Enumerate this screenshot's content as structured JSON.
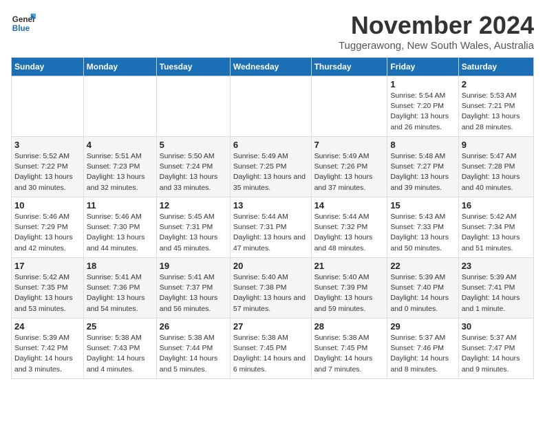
{
  "header": {
    "logo_line1": "General",
    "logo_line2": "Blue",
    "month": "November 2024",
    "location": "Tuggerawong, New South Wales, Australia"
  },
  "weekdays": [
    "Sunday",
    "Monday",
    "Tuesday",
    "Wednesday",
    "Thursday",
    "Friday",
    "Saturday"
  ],
  "weeks": [
    [
      {
        "day": "",
        "detail": ""
      },
      {
        "day": "",
        "detail": ""
      },
      {
        "day": "",
        "detail": ""
      },
      {
        "day": "",
        "detail": ""
      },
      {
        "day": "",
        "detail": ""
      },
      {
        "day": "1",
        "detail": "Sunrise: 5:54 AM\nSunset: 7:20 PM\nDaylight: 13 hours and 26 minutes."
      },
      {
        "day": "2",
        "detail": "Sunrise: 5:53 AM\nSunset: 7:21 PM\nDaylight: 13 hours and 28 minutes."
      }
    ],
    [
      {
        "day": "3",
        "detail": "Sunrise: 5:52 AM\nSunset: 7:22 PM\nDaylight: 13 hours and 30 minutes."
      },
      {
        "day": "4",
        "detail": "Sunrise: 5:51 AM\nSunset: 7:23 PM\nDaylight: 13 hours and 32 minutes."
      },
      {
        "day": "5",
        "detail": "Sunrise: 5:50 AM\nSunset: 7:24 PM\nDaylight: 13 hours and 33 minutes."
      },
      {
        "day": "6",
        "detail": "Sunrise: 5:49 AM\nSunset: 7:25 PM\nDaylight: 13 hours and 35 minutes."
      },
      {
        "day": "7",
        "detail": "Sunrise: 5:49 AM\nSunset: 7:26 PM\nDaylight: 13 hours and 37 minutes."
      },
      {
        "day": "8",
        "detail": "Sunrise: 5:48 AM\nSunset: 7:27 PM\nDaylight: 13 hours and 39 minutes."
      },
      {
        "day": "9",
        "detail": "Sunrise: 5:47 AM\nSunset: 7:28 PM\nDaylight: 13 hours and 40 minutes."
      }
    ],
    [
      {
        "day": "10",
        "detail": "Sunrise: 5:46 AM\nSunset: 7:29 PM\nDaylight: 13 hours and 42 minutes."
      },
      {
        "day": "11",
        "detail": "Sunrise: 5:46 AM\nSunset: 7:30 PM\nDaylight: 13 hours and 44 minutes."
      },
      {
        "day": "12",
        "detail": "Sunrise: 5:45 AM\nSunset: 7:31 PM\nDaylight: 13 hours and 45 minutes."
      },
      {
        "day": "13",
        "detail": "Sunrise: 5:44 AM\nSunset: 7:31 PM\nDaylight: 13 hours and 47 minutes."
      },
      {
        "day": "14",
        "detail": "Sunrise: 5:44 AM\nSunset: 7:32 PM\nDaylight: 13 hours and 48 minutes."
      },
      {
        "day": "15",
        "detail": "Sunrise: 5:43 AM\nSunset: 7:33 PM\nDaylight: 13 hours and 50 minutes."
      },
      {
        "day": "16",
        "detail": "Sunrise: 5:42 AM\nSunset: 7:34 PM\nDaylight: 13 hours and 51 minutes."
      }
    ],
    [
      {
        "day": "17",
        "detail": "Sunrise: 5:42 AM\nSunset: 7:35 PM\nDaylight: 13 hours and 53 minutes."
      },
      {
        "day": "18",
        "detail": "Sunrise: 5:41 AM\nSunset: 7:36 PM\nDaylight: 13 hours and 54 minutes."
      },
      {
        "day": "19",
        "detail": "Sunrise: 5:41 AM\nSunset: 7:37 PM\nDaylight: 13 hours and 56 minutes."
      },
      {
        "day": "20",
        "detail": "Sunrise: 5:40 AM\nSunset: 7:38 PM\nDaylight: 13 hours and 57 minutes."
      },
      {
        "day": "21",
        "detail": "Sunrise: 5:40 AM\nSunset: 7:39 PM\nDaylight: 13 hours and 59 minutes."
      },
      {
        "day": "22",
        "detail": "Sunrise: 5:39 AM\nSunset: 7:40 PM\nDaylight: 14 hours and 0 minutes."
      },
      {
        "day": "23",
        "detail": "Sunrise: 5:39 AM\nSunset: 7:41 PM\nDaylight: 14 hours and 1 minute."
      }
    ],
    [
      {
        "day": "24",
        "detail": "Sunrise: 5:39 AM\nSunset: 7:42 PM\nDaylight: 14 hours and 3 minutes."
      },
      {
        "day": "25",
        "detail": "Sunrise: 5:38 AM\nSunset: 7:43 PM\nDaylight: 14 hours and 4 minutes."
      },
      {
        "day": "26",
        "detail": "Sunrise: 5:38 AM\nSunset: 7:44 PM\nDaylight: 14 hours and 5 minutes."
      },
      {
        "day": "27",
        "detail": "Sunrise: 5:38 AM\nSunset: 7:45 PM\nDaylight: 14 hours and 6 minutes."
      },
      {
        "day": "28",
        "detail": "Sunrise: 5:38 AM\nSunset: 7:45 PM\nDaylight: 14 hours and 7 minutes."
      },
      {
        "day": "29",
        "detail": "Sunrise: 5:37 AM\nSunset: 7:46 PM\nDaylight: 14 hours and 8 minutes."
      },
      {
        "day": "30",
        "detail": "Sunrise: 5:37 AM\nSunset: 7:47 PM\nDaylight: 14 hours and 9 minutes."
      }
    ]
  ]
}
